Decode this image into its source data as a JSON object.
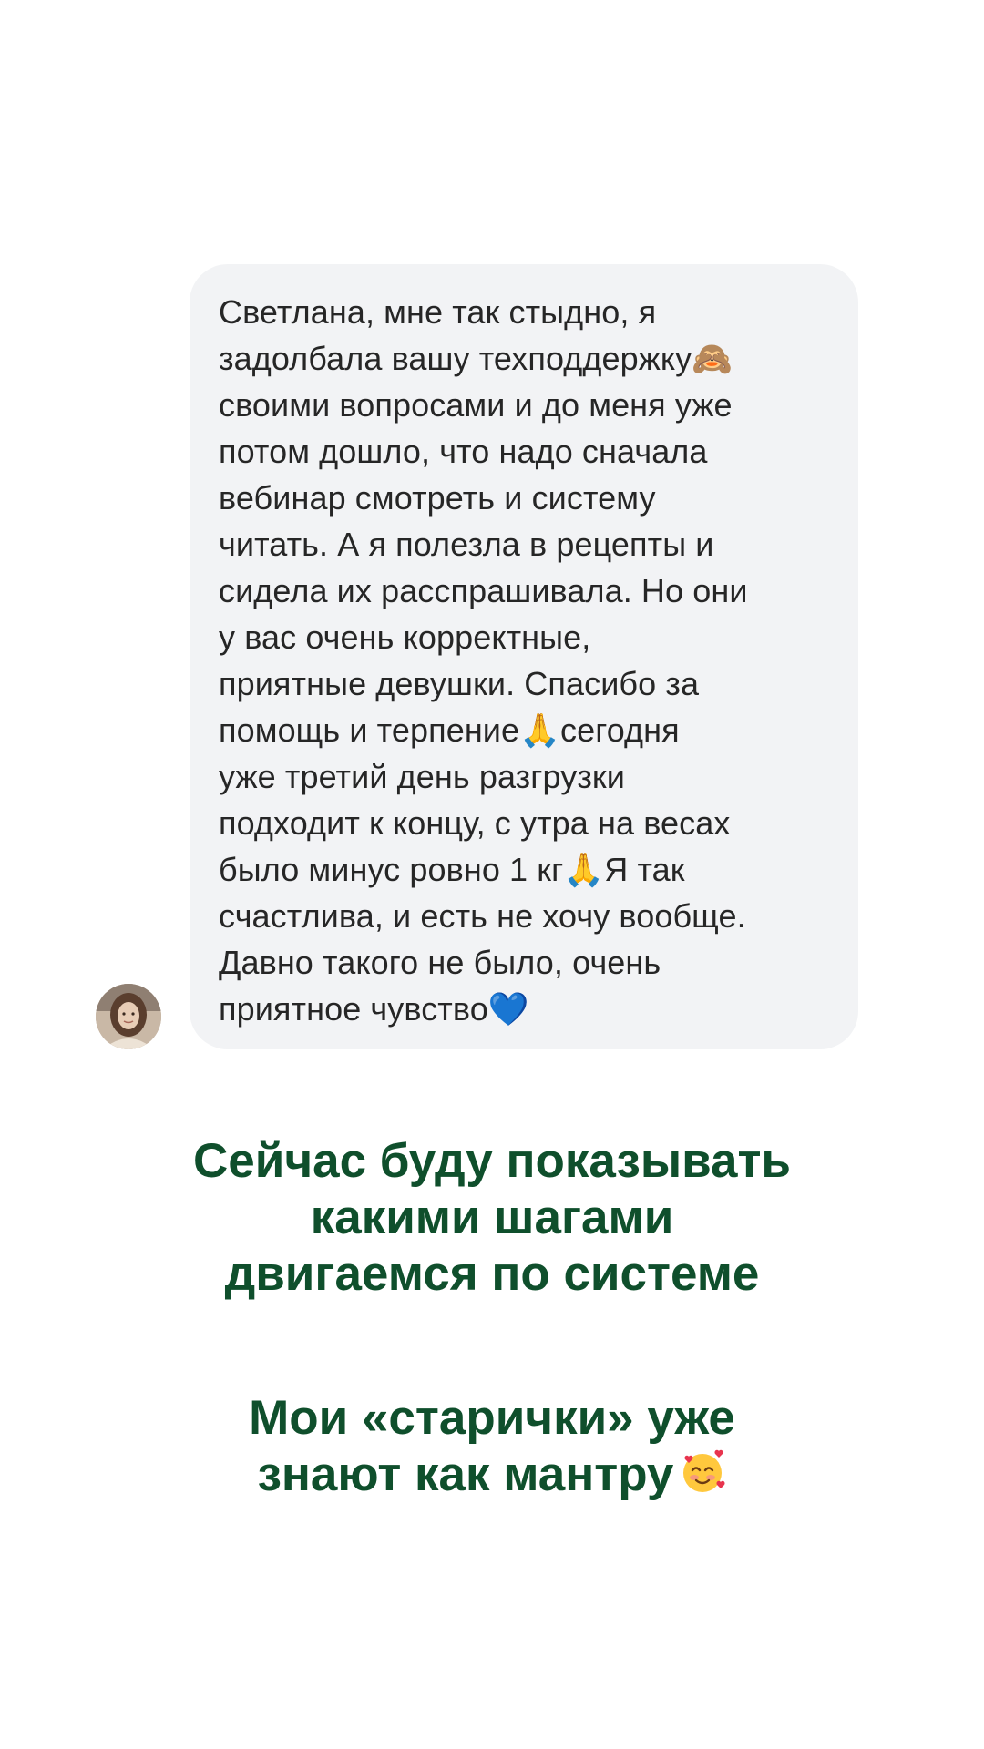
{
  "message": {
    "lines": [
      "Светлана, мне так стыдно, я",
      "задолбала вашу техподдержку🙈",
      "своими вопросами и до меня уже",
      "потом дошло, что надо сначала",
      "вебинар смотреть и систему",
      "читать. А я полезла в рецепты и",
      "сидела их расспрашивала. Но они",
      "у вас очень корректные,",
      "приятные девушки. Спасибо за",
      "помощь и терпение🙏сегодня",
      "уже третий день разгрузки",
      "подходит к концу, с утра на весах",
      "было минус ровно 1 кг🙏Я так",
      "счастлива, и есть не хочу вообще.",
      "Давно такого не было, очень",
      "приятное чувство💙"
    ]
  },
  "caption_1": {
    "lines": [
      "Сейчас буду показывать",
      "какими шагами",
      "двигаемся по системе"
    ]
  },
  "caption_2": {
    "lines": [
      "Мои «старички» уже",
      "знают как мантру"
    ],
    "emoji_icon": "smiling-face-with-hearts-icon"
  },
  "colors": {
    "caption": "#0f4f2c",
    "bubble_background": "#f2f3f5",
    "message_text": "#262626",
    "page_background": "#ffffff"
  }
}
